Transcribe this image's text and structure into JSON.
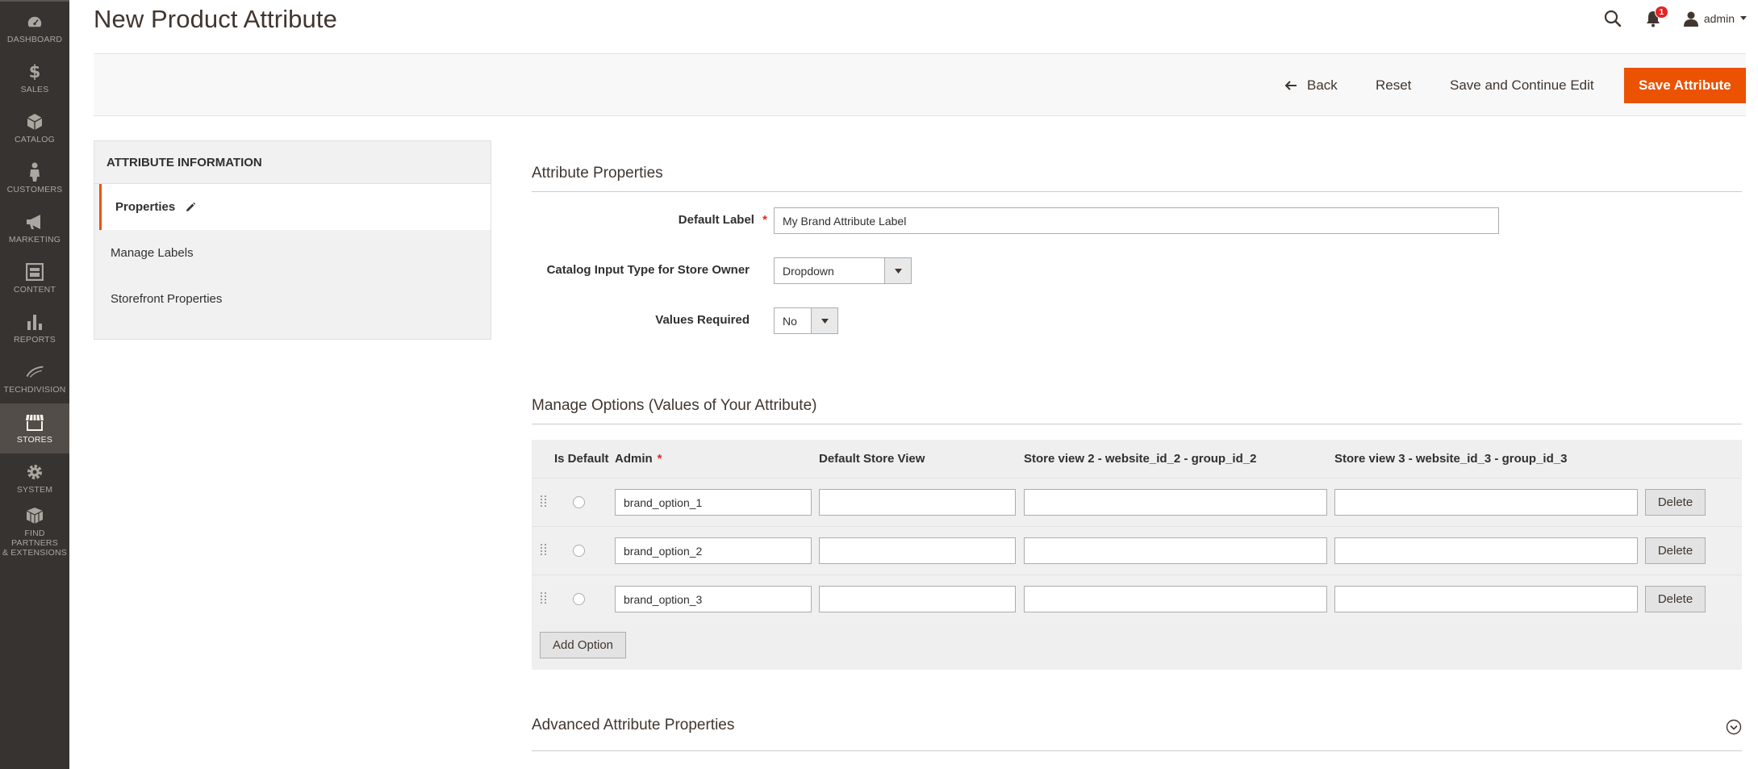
{
  "sidebar": {
    "items": [
      {
        "label": "Dashboard",
        "icon": "dashboard-icon"
      },
      {
        "label": "Sales",
        "icon": "dollar-icon"
      },
      {
        "label": "Catalog",
        "icon": "cube-icon"
      },
      {
        "label": "Customers",
        "icon": "person-icon"
      },
      {
        "label": "Marketing",
        "icon": "megaphone-icon"
      },
      {
        "label": "Content",
        "icon": "layout-icon"
      },
      {
        "label": "Reports",
        "icon": "bar-chart-icon"
      },
      {
        "label": "Techdivision",
        "icon": "techdivision-logo-icon"
      },
      {
        "label": "Stores",
        "icon": "store-icon",
        "active": true
      },
      {
        "label": "System",
        "icon": "gear-icon"
      },
      {
        "label": "Find Partners & Extensions",
        "label_line1": "Find Partners",
        "label_line2": "& Extensions",
        "icon": "boxes-icon"
      }
    ]
  },
  "header": {
    "title": "New Product Attribute",
    "notifications_count": "1",
    "user": "admin"
  },
  "actions": {
    "back": "Back",
    "reset": "Reset",
    "save_continue": "Save and Continue Edit",
    "save": "Save Attribute"
  },
  "left_panel": {
    "title": "Attribute Information",
    "tabs": [
      "Properties",
      "Manage Labels",
      "Storefront Properties"
    ]
  },
  "properties": {
    "section_title": "Attribute Properties",
    "default_label": {
      "label": "Default Label",
      "value": "My Brand Attribute Label"
    },
    "input_type": {
      "label": "Catalog Input Type for Store Owner",
      "value": "Dropdown"
    },
    "values_required": {
      "label": "Values Required",
      "value": "No"
    }
  },
  "options": {
    "section_title": "Manage Options (Values of Your Attribute)",
    "columns": [
      "Is Default",
      "Admin",
      "Default Store View",
      "Store view 2 - website_id_2 - group_id_2",
      "Store view 3 - website_id_3 - group_id_3"
    ],
    "rows": [
      {
        "admin": "brand_option_1",
        "default_store_view": "",
        "store_view_2": "",
        "store_view_3": ""
      },
      {
        "admin": "brand_option_2",
        "default_store_view": "",
        "store_view_2": "",
        "store_view_3": ""
      },
      {
        "admin": "brand_option_3",
        "default_store_view": "",
        "store_view_2": "",
        "store_view_3": ""
      }
    ],
    "delete_label": "Delete",
    "add_option_label": "Add Option"
  },
  "advanced": {
    "section_title": "Advanced Attribute Properties"
  },
  "colors": {
    "sidebar_bg": "#373330",
    "accent": "#eb5202",
    "required": "#e22626"
  }
}
